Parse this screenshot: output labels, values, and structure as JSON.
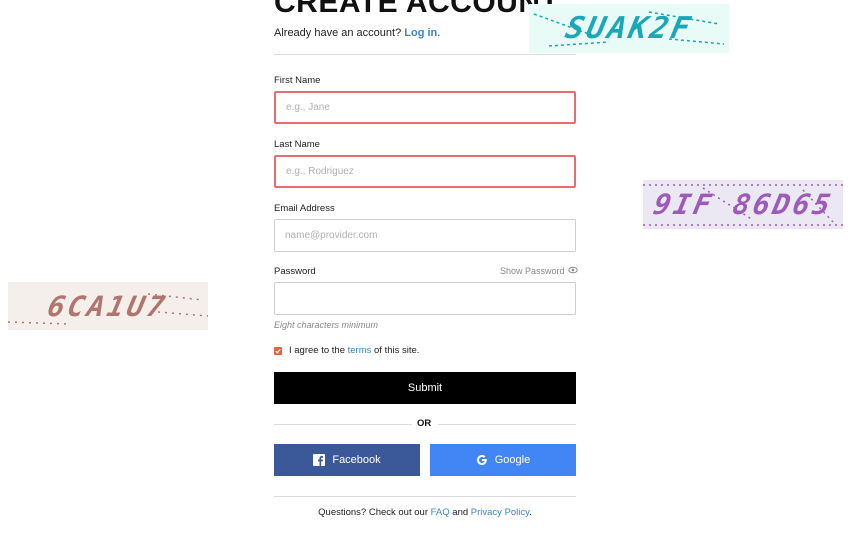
{
  "header": {
    "title": "CREATE ACCOUNT",
    "login_prompt": "Already have an account?",
    "login_link": "Log in",
    "login_suffix": "."
  },
  "form": {
    "first_name": {
      "label": "First Name",
      "placeholder": "e.g., Jane",
      "value": "",
      "state": "error"
    },
    "last_name": {
      "label": "Last Name",
      "placeholder": "e.g., Rodriguez",
      "value": "",
      "state": "error"
    },
    "email": {
      "label": "Email Address",
      "placeholder": "name@provider.com",
      "value": ""
    },
    "password": {
      "label": "Password",
      "show_label": "Show Password",
      "hint": "Eight characters minimum",
      "value": ""
    },
    "agree": {
      "checked": true,
      "prefix": "I agree to the",
      "link": "terms",
      "suffix": "of this site."
    },
    "submit_label": "Submit"
  },
  "divider": {
    "label": "OR"
  },
  "social": {
    "facebook_label": "Facebook",
    "google_label": "Google"
  },
  "footer": {
    "prefix": "Questions? Check out our",
    "faq": "FAQ",
    "and": "and",
    "privacy": "Privacy Policy",
    "suffix": "."
  },
  "captchas": [
    {
      "text": "SUAK2F"
    },
    {
      "text": "9IF 86D65"
    },
    {
      "text": "6CA1U7"
    }
  ],
  "colors": {
    "accent": "#3a85c8",
    "error_border": "#e56f6f",
    "facebook": "#3b5998",
    "google": "#4285f4",
    "checkbox": "#e0643c"
  }
}
